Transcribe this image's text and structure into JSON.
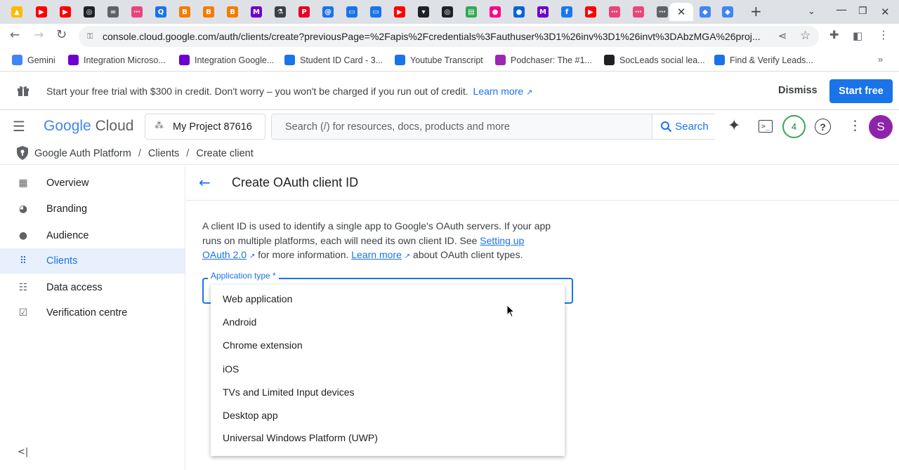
{
  "browser": {
    "tabs": [
      {
        "icon": "google-ads-icon",
        "color": "#fbbc04"
      },
      {
        "icon": "youtube-icon",
        "color": "#ff0000"
      },
      {
        "icon": "youtube-icon",
        "color": "#ff0000"
      },
      {
        "icon": "openai-icon",
        "color": "#202124"
      },
      {
        "icon": "link-icon",
        "color": "#5f6368"
      },
      {
        "icon": "integration-icon",
        "color": "#e8457a"
      },
      {
        "icon": "q-icon",
        "color": "#1a73e8"
      },
      {
        "icon": "blogger-icon",
        "color": "#f57c00"
      },
      {
        "icon": "blogger-icon",
        "color": "#f57c00"
      },
      {
        "icon": "blogger-icon",
        "color": "#f57c00"
      },
      {
        "icon": "make-icon",
        "color": "#6d00cc"
      },
      {
        "icon": "flask-icon",
        "color": "#3c4043"
      },
      {
        "icon": "pinterest-icon",
        "color": "#e60023"
      },
      {
        "icon": "at-sign-icon",
        "color": "#1a73e8"
      },
      {
        "icon": "chat-icon",
        "color": "#1a73e8"
      },
      {
        "icon": "chat-icon",
        "color": "#1a73e8"
      },
      {
        "icon": "youtube-icon",
        "color": "#ff0000"
      },
      {
        "icon": "hat-icon",
        "color": "#202124"
      },
      {
        "icon": "openai-icon",
        "color": "#202124"
      },
      {
        "icon": "sheets-icon",
        "color": "#34a853"
      },
      {
        "icon": "flickr-icon",
        "color": "#ff0084"
      },
      {
        "icon": "flickr-icon",
        "color": "#0063dc"
      },
      {
        "icon": "make-icon",
        "color": "#6d00cc"
      },
      {
        "icon": "facebook-icon",
        "color": "#1877f2"
      },
      {
        "icon": "youtube-icon",
        "color": "#ff0000"
      },
      {
        "icon": "integration-icon",
        "color": "#e8457a"
      },
      {
        "icon": "integration-icon",
        "color": "#e8457a"
      },
      {
        "icon": "integration-icon",
        "color": "#5f6368"
      },
      {
        "icon": "shield-icon",
        "color": "#4285f4"
      },
      {
        "icon": "shield-icon",
        "color": "#4285f4"
      }
    ],
    "url": "console.cloud.google.com/auth/clients/create?previousPage=%2Fapis%2Fcredentials%3Fauthuser%3D1%26inv%3D1%26invt%3DAbzMGA%26proj...",
    "bookmarks": [
      {
        "label": "Gemini",
        "color": "#4285f4"
      },
      {
        "label": "Integration Microso...",
        "color": "#6d00cc"
      },
      {
        "label": "Integration Google...",
        "color": "#6d00cc"
      },
      {
        "label": "Student ID Card - 3...",
        "color": "#1a73e8"
      },
      {
        "label": "Youtube Transcript",
        "color": "#1a73e8"
      },
      {
        "label": "Podchaser: The #1...",
        "color": "#9c27b0"
      },
      {
        "label": "SocLeads social lea...",
        "color": "#202124"
      },
      {
        "label": "Find & Verify Leads...",
        "color": "#1a73e8"
      }
    ],
    "bookmarks_more": "»"
  },
  "banner": {
    "text": "Start your free trial with $300 in credit. Don't worry – you won't be charged if you run out of credit.",
    "learn_more": "Learn more",
    "dismiss": "Dismiss",
    "start_free": "Start free"
  },
  "header": {
    "logo_google": "Google",
    "logo_cloud": "Cloud",
    "project": "My Project 87616",
    "search_placeholder": "Search (/) for resources, docs, products and more",
    "search_button": "Search",
    "notification_count": "4",
    "avatar_letter": "S",
    "accent": "#1a73e8"
  },
  "breadcrumb": {
    "items": [
      "Google Auth Platform",
      "Clients",
      "Create client"
    ],
    "separator": "/"
  },
  "sidebar": {
    "items": [
      {
        "label": "Overview",
        "icon": "dashboard-icon"
      },
      {
        "label": "Branding",
        "icon": "palette-icon"
      },
      {
        "label": "Audience",
        "icon": "person-icon"
      },
      {
        "label": "Clients",
        "icon": "grid-icon"
      },
      {
        "label": "Data access",
        "icon": "data-access-icon"
      },
      {
        "label": "Verification centre",
        "icon": "verified-icon"
      }
    ],
    "active_index": 3
  },
  "main": {
    "title": "Create OAuth client ID",
    "desc_1": "A client ID is used to identify a single app to Google's OAuth servers. If your app",
    "desc_2a": "runs on multiple platforms, each will need its own client ID. See ",
    "desc_link1a": "Setting up",
    "desc_link1b": "OAuth 2.0",
    "desc_3a": " for more information. ",
    "desc_link2": "Learn more",
    "desc_3b": " about OAuth client types.",
    "field_label": "Application type *",
    "options": [
      "Web application",
      "Android",
      "Chrome extension",
      "iOS",
      "TVs and Limited Input devices",
      "Desktop app",
      "Universal Windows Platform (UWP)"
    ]
  }
}
